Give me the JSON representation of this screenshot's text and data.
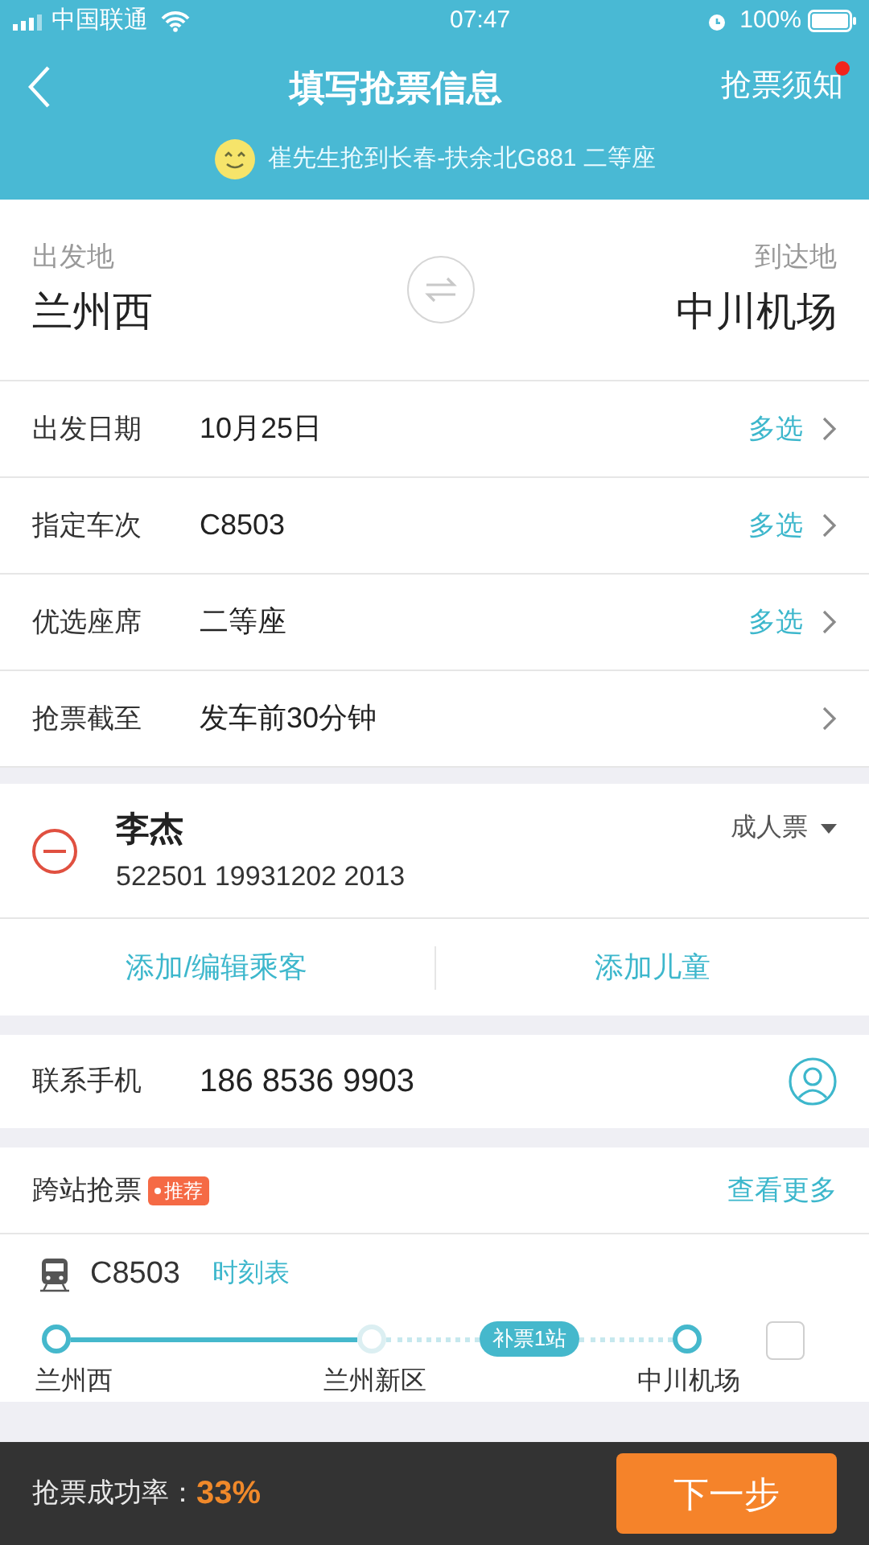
{
  "status_bar": {
    "carrier": "中国联通",
    "time": "07:47",
    "battery": "100%"
  },
  "header": {
    "title": "填写抢票信息",
    "notice_link": "抢票须知",
    "notice_unread": true,
    "ticker": "崔先生抢到长春-扶余北G881 二等座"
  },
  "route": {
    "from_label": "出发地",
    "from": "兰州西",
    "to_label": "到达地",
    "to": "中川机场"
  },
  "rows": [
    {
      "label": "出发日期",
      "value": "10月25日",
      "action": "多选"
    },
    {
      "label": "指定车次",
      "value": "C8503",
      "action": "多选"
    },
    {
      "label": "优选座席",
      "value": "二等座",
      "action": "多选"
    },
    {
      "label": "抢票截至",
      "value": "发车前30分钟"
    }
  ],
  "passenger": {
    "name": "李杰",
    "id_number": "522501 19931202 2013",
    "ticket_type": "成人票"
  },
  "passenger_actions": [
    "添加/编辑乘客",
    "添加儿童"
  ],
  "contact": {
    "label": "联系手机",
    "value": "186 8536 9903"
  },
  "cross_station": {
    "title": "跨站抢票",
    "badge": "推荐",
    "more": "查看更多",
    "train": "C8503",
    "timetable": "时刻表",
    "extra_badge": "补票1站",
    "checked": false,
    "stations": [
      {
        "name": "兰州西",
        "on_route": true
      },
      {
        "name": "兰州新区",
        "on_route": false
      },
      {
        "name": "中川机场",
        "on_route": true
      }
    ]
  },
  "footer": {
    "rate_label": "抢票成功率：",
    "rate": "33%",
    "next": "下一步"
  }
}
